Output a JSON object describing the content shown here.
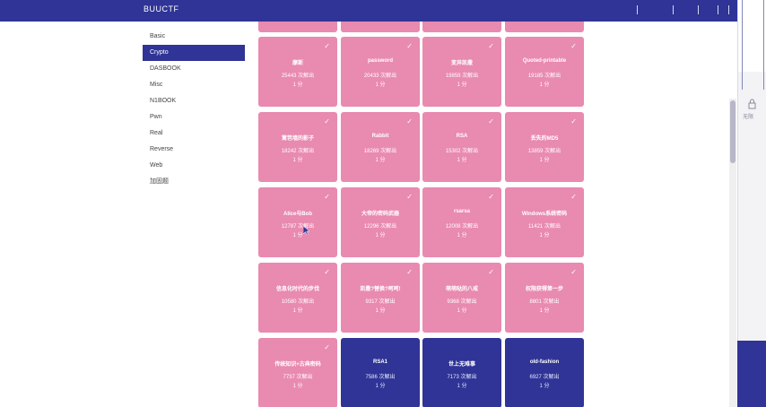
{
  "app": {
    "brand": "BUUCTF"
  },
  "sidebar": {
    "items": [
      {
        "label": "Basic",
        "active": false
      },
      {
        "label": "Crypto",
        "active": true
      },
      {
        "label": "DASBOOK",
        "active": false
      },
      {
        "label": "Misc",
        "active": false
      },
      {
        "label": "N1BOOK",
        "active": false
      },
      {
        "label": "Pwn",
        "active": false
      },
      {
        "label": "Real",
        "active": false
      },
      {
        "label": "Reverse",
        "active": false
      },
      {
        "label": "Web",
        "active": false
      },
      {
        "label": "加固题",
        "active": false
      }
    ]
  },
  "challenges": [
    {
      "name": "摩斯",
      "count": "25443 次解出",
      "score": "1 分",
      "solved": true
    },
    {
      "name": "password",
      "count": "20433 次解出",
      "score": "1 分",
      "solved": true
    },
    {
      "name": "变异凯撒",
      "count": "19859 次解出",
      "score": "1 分",
      "solved": true
    },
    {
      "name": "Quoted-printable",
      "count": "19185 次解出",
      "score": "1 分",
      "solved": true
    },
    {
      "name": "篱笆墙的影子",
      "count": "18242 次解出",
      "score": "1 分",
      "solved": true
    },
    {
      "name": "Rabbit",
      "count": "18269 次解出",
      "score": "1 分",
      "solved": true
    },
    {
      "name": "RSA",
      "count": "15302 次解出",
      "score": "1 分",
      "solved": true
    },
    {
      "name": "丢失的MD5",
      "count": "13859 次解出",
      "score": "1 分",
      "solved": true
    },
    {
      "name": "Alice与Bob",
      "count": "12787 次解出",
      "score": "1 分",
      "solved": true
    },
    {
      "name": "大帝的密码武器",
      "count": "12296 次解出",
      "score": "1 分",
      "solved": true
    },
    {
      "name": "rsarsa",
      "count": "12008 次解出",
      "score": "1 分",
      "solved": true
    },
    {
      "name": "Windows系统密码",
      "count": "11421 次解出",
      "score": "1 分",
      "solved": true
    },
    {
      "name": "信息化时代的步伐",
      "count": "10580 次解出",
      "score": "1 分",
      "solved": true
    },
    {
      "name": "凯撒?替换?呵呵!",
      "count": "9317 次解出",
      "score": "1 分",
      "solved": true
    },
    {
      "name": "萌萌哒的八戒",
      "count": "9368 次解出",
      "score": "1 分",
      "solved": true
    },
    {
      "name": "权限获得第一步",
      "count": "8801 次解出",
      "score": "1 分",
      "solved": true
    },
    {
      "name": "传统知识+古典密码",
      "count": "7737 次解出",
      "score": "1 分",
      "solved": true
    },
    {
      "name": "RSA1",
      "count": "7586 次解出",
      "score": "1 分",
      "solved": false
    },
    {
      "name": "世上无难事",
      "count": "7173 次解出",
      "score": "1 分",
      "solved": false
    },
    {
      "name": "old-fashion",
      "count": "6927 次解出",
      "score": "1 分",
      "solved": false
    }
  ],
  "right_panel": {
    "label": "无限"
  },
  "colors": {
    "nav": "#2f3496",
    "solved_card": "#e98ab0",
    "unsolved_card": "#2f3496"
  }
}
